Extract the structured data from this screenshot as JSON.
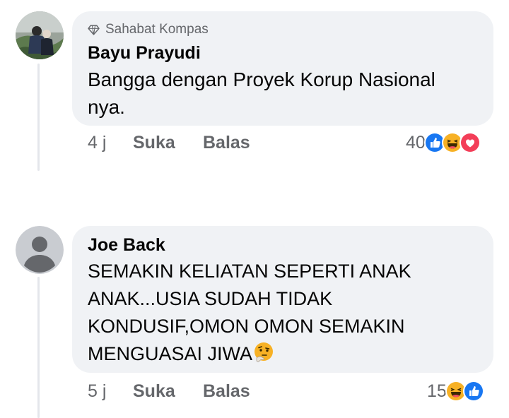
{
  "comments": [
    {
      "badge": "Sahabat Kompas",
      "author": "Bayu Prayudi",
      "text_lines": [
        "Bangga dengan Proyek Korup Nasional",
        "nya."
      ],
      "time": "4 j",
      "like_label": "Suka",
      "reply_label": "Balas",
      "reaction_count": "40",
      "reactions": [
        "like-icon",
        "haha-icon",
        "love-icon"
      ]
    },
    {
      "author": "Joe Back",
      "text_lines": [
        "SEMAKIN KELIATAN SEPERTI ANAK",
        "ANAK...USIA SUDAH TIDAK",
        "KONDUSIF,OMON OMON SEMAKIN",
        "MENGUASAI JIWA"
      ],
      "inline_emoji": "thinking-face-icon",
      "time": "5 j",
      "like_label": "Suka",
      "reply_label": "Balas",
      "reaction_count": "15",
      "reactions": [
        "haha-icon",
        "like-icon"
      ]
    }
  ],
  "colors": {
    "bubble": "#f0f2f5",
    "secondary_text": "#65676b",
    "primary_text": "#050505",
    "like_blue": "#1877f2",
    "love_red": "#f33e58",
    "haha_yellow": "#f7b125"
  }
}
